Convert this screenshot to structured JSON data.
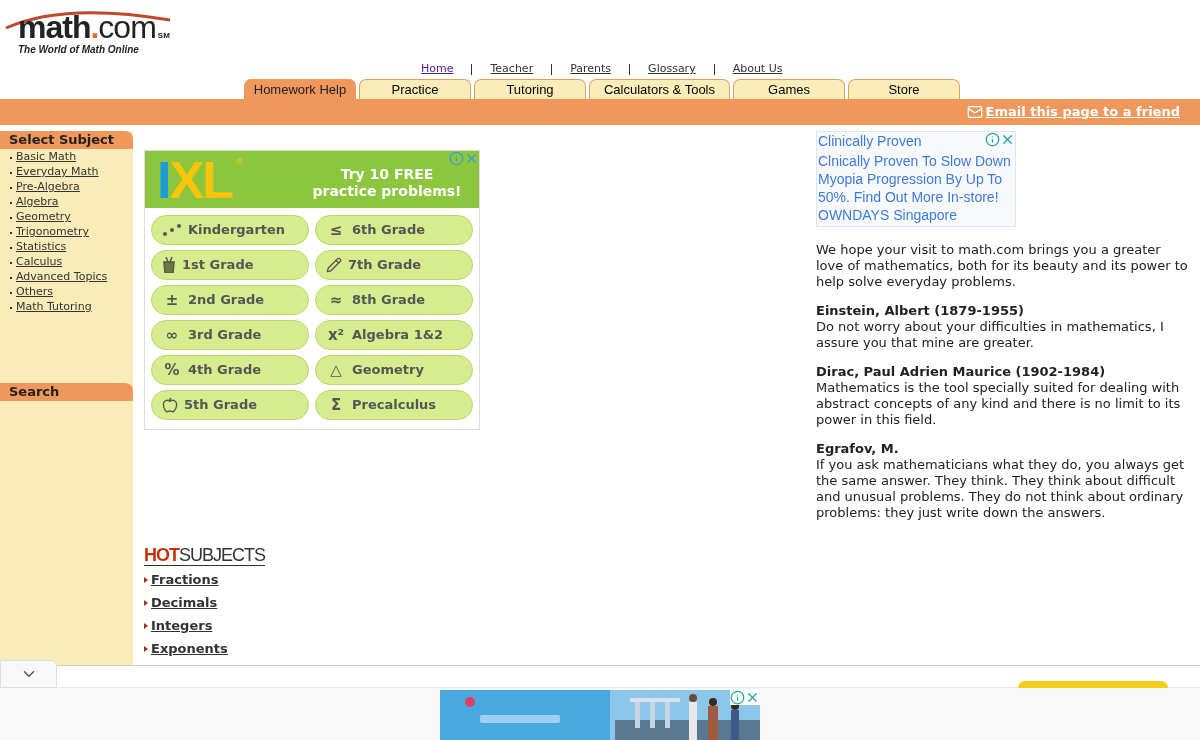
{
  "logo": {
    "name": "math",
    "dot": ".",
    "tld": "com",
    "mark": "SM",
    "tagline": "The World of Math Online"
  },
  "top_links": [
    "Home",
    "Teacher",
    "Parents",
    "Glossary",
    "About Us"
  ],
  "tabs": [
    {
      "label": "Homework Help",
      "selected": true
    },
    {
      "label": "Practice",
      "selected": false
    },
    {
      "label": "Tutoring",
      "selected": false
    },
    {
      "label": "Calculators & Tools",
      "selected": false
    },
    {
      "label": "Games",
      "selected": false
    },
    {
      "label": "Store",
      "selected": false
    }
  ],
  "email_link": "Email this page to a friend",
  "sidebar": {
    "subject_heading": "Select Subject",
    "subjects": [
      "Basic Math",
      "Everyday Math",
      "Pre-Algebra",
      "Algebra",
      "Geometry",
      "Trigonometry",
      "Statistics",
      "Calculus",
      "Advanced Topics",
      "Others",
      "Math Tutoring"
    ],
    "search_heading": "Search"
  },
  "ixl_ad": {
    "logo": "IXL",
    "registered": "®",
    "headline": "Try 10 FREE practice problems!",
    "grades": [
      {
        "label": "Kindergarten"
      },
      {
        "label": "6th Grade",
        "symbol": "≤"
      },
      {
        "label": "1st Grade"
      },
      {
        "label": "7th Grade"
      },
      {
        "label": "2nd Grade",
        "symbol": "±"
      },
      {
        "label": "8th Grade",
        "symbol": "≈"
      },
      {
        "label": "3rd Grade",
        "symbol": "∞"
      },
      {
        "label": "Algebra 1&2",
        "symbol": "x²"
      },
      {
        "label": "4th Grade",
        "symbol": "%"
      },
      {
        "label": "Geometry",
        "symbol": "△"
      },
      {
        "label": "5th Grade"
      },
      {
        "label": "Precalculus",
        "symbol": "Σ"
      }
    ]
  },
  "hot_subjects": {
    "heading": "**HOT**SUBJECTS",
    "links": [
      "Fractions",
      "Decimals",
      "Integers",
      "Exponents"
    ]
  },
  "text_ad": {
    "title": "Clinically Proven",
    "body": "Clnically Proven To Slow Down Myopia Progression By Up To 50%. Find Out More In-store! OWNDAYS Singapore"
  },
  "intro": "We hope your visit to math.com brings you a greater love of mathematics, both for its beauty and its power to help solve everyday problems.",
  "quotes": [
    {
      "author": "Einstein, Albert (1879-1955)",
      "text": "Do not worry about your difficulties in mathematics, I assure you that mine are greater."
    },
    {
      "author": "Dirac, Paul Adrien Maurice (1902-1984)",
      "text": "Mathematics is the tool specially suited for dealing with abstract concepts of any kind and there is no limit to its power in this field."
    },
    {
      "author": "Egrafov, M.",
      "text": "If you ask mathematicians what they do, you always get the same answer. They think. They think about difficult and unusual problems. They do not think about ordinary problems: they just write down the answers."
    }
  ],
  "banner_ad": {
    "kind": "picture"
  }
}
